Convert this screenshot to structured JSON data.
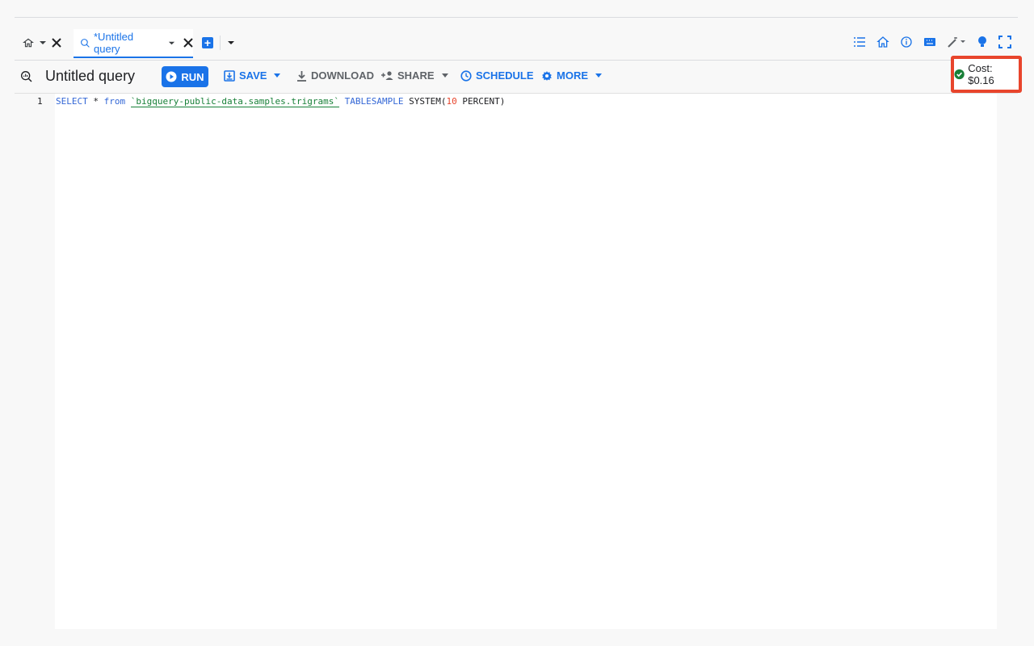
{
  "tabs": {
    "home_icon": "home-icon",
    "active_tab_label": "*Untitled query",
    "add_icon": "+"
  },
  "toolbar": {
    "query_title": "Untitled query",
    "run_label": "RUN",
    "save_label": "SAVE",
    "download_label": "DOWNLOAD",
    "share_label": "SHARE",
    "schedule_label": "SCHEDULE",
    "more_label": "MORE",
    "cost_text": "Cost: $0.16"
  },
  "editor": {
    "line_number": "1",
    "tokens": {
      "select": "SELECT",
      "star": " * ",
      "from": "from",
      "space": " ",
      "table": "`bigquery-public-data.samples.trigrams`",
      "tablesample": "TABLESAMPLE",
      "system": "SYSTEM(",
      "pct_value": "10",
      "percent": " PERCENT)"
    }
  },
  "colors": {
    "accent": "#1a73e8",
    "highlight": "#e8452c",
    "success": "#188038"
  }
}
